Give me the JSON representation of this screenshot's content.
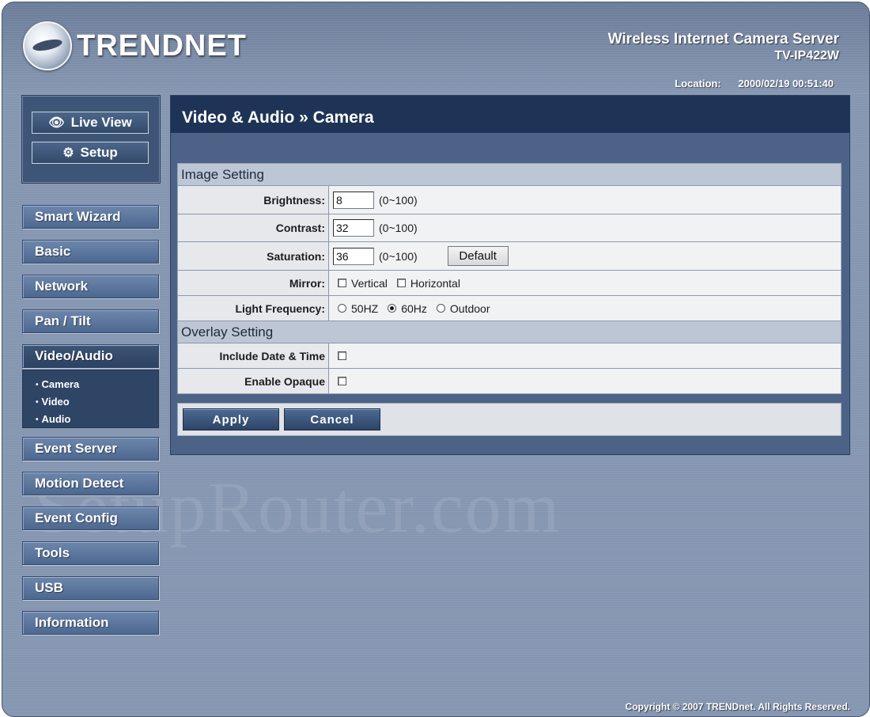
{
  "header": {
    "brand": "TRENDNET",
    "product_line1": "Wireless Internet Camera Server",
    "product_line2": "TV-IP422W",
    "location_label": "Location:",
    "datetime": "2000/02/19 00:51:40"
  },
  "view_buttons": {
    "live_view": "Live View",
    "setup": "Setup"
  },
  "nav": {
    "items": [
      "Smart Wizard",
      "Basic",
      "Network",
      "Pan / Tilt",
      "Video/Audio",
      "Event Server",
      "Motion Detect",
      "Event Config",
      "Tools",
      "USB",
      "Information"
    ],
    "sub_items": [
      "Camera",
      "Video",
      "Audio"
    ]
  },
  "page": {
    "title": "Video & Audio » Camera"
  },
  "image_setting": {
    "header": "Image Setting",
    "brightness_label": "Brightness:",
    "brightness_value": "8",
    "brightness_range": "(0~100)",
    "contrast_label": "Contrast:",
    "contrast_value": "32",
    "contrast_range": "(0~100)",
    "saturation_label": "Saturation:",
    "saturation_value": "36",
    "saturation_range": "(0~100)",
    "default_button": "Default",
    "mirror_label": "Mirror:",
    "mirror_vertical": "Vertical",
    "mirror_horizontal": "Horizontal",
    "light_label": "Light Frequency:",
    "light_50": "50HZ",
    "light_60": "60Hz",
    "light_outdoor": "Outdoor",
    "light_selected": "60Hz"
  },
  "overlay_setting": {
    "header": "Overlay Setting",
    "date_time_label": "Include Date & Time",
    "opaque_label": "Enable Opaque"
  },
  "actions": {
    "apply": "Apply",
    "cancel": "Cancel"
  },
  "footer": {
    "copyright": "Copyright © 2007 TRENDnet. All Rights Reserved.",
    "watermark": "SetupRouter.com"
  },
  "colors": {
    "background": "#8596b1",
    "title_bar": "#1e3456",
    "nav_button": "#5a749c"
  }
}
